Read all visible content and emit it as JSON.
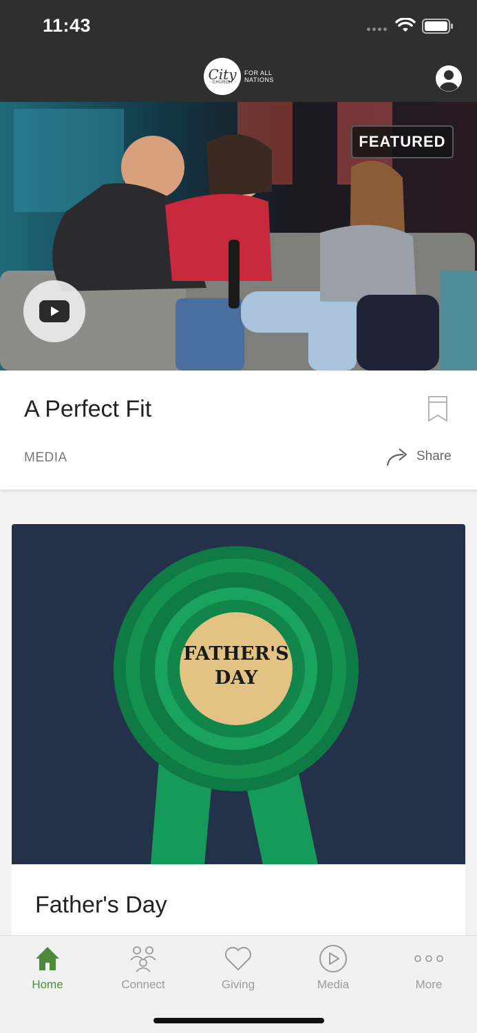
{
  "status": {
    "time": "11:43"
  },
  "header": {
    "logo_word": "City",
    "logo_sub": "CHURCH",
    "logo_tagline": "FOR ALL NATIONS"
  },
  "featured": {
    "badge": "FEATURED",
    "title": "A Perfect Fit",
    "category": "MEDIA",
    "share_label": "Share"
  },
  "second_card": {
    "ribbon_text_line1": "FATHER'S",
    "ribbon_text_line2": "DAY",
    "title": "Father's Day"
  },
  "tabs": [
    {
      "label": "Home",
      "icon": "home-icon",
      "active": true
    },
    {
      "label": "Connect",
      "icon": "connect-icon",
      "active": false
    },
    {
      "label": "Giving",
      "icon": "heart-icon",
      "active": false
    },
    {
      "label": "Media",
      "icon": "play-circle-icon",
      "active": false
    },
    {
      "label": "More",
      "icon": "more-dots-icon",
      "active": false
    }
  ],
  "colors": {
    "header_bg": "#2f2f2f",
    "accent_green": "#4f8a3c",
    "tab_inactive": "#9a9a9a"
  }
}
